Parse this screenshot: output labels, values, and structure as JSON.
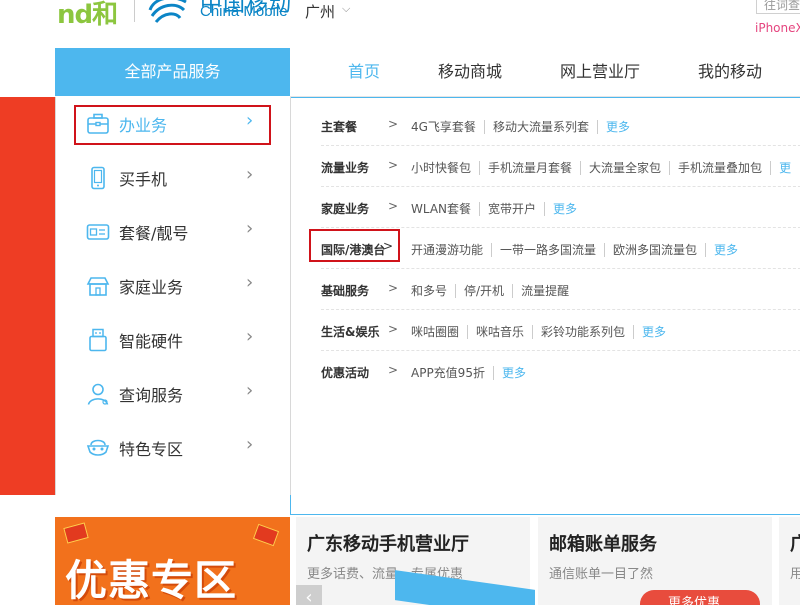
{
  "header": {
    "logo_he": "和",
    "brand_cn": "中国移动",
    "brand_en": "China Mobile",
    "city": "广州",
    "search_placeholder": "往词查",
    "hot_word": "iPhoneX"
  },
  "nav": {
    "all_services": "全部产品服务",
    "tabs": [
      {
        "label": "首页",
        "active": true
      },
      {
        "label": "移动商城",
        "active": false
      },
      {
        "label": "网上营业厅",
        "active": false
      },
      {
        "label": "我的移动",
        "active": false
      }
    ]
  },
  "menu": {
    "items": [
      {
        "label": "办业务",
        "icon": "briefcase-icon",
        "active": true
      },
      {
        "label": "买手机",
        "icon": "phone-icon",
        "active": false
      },
      {
        "label": "套餐/靓号",
        "icon": "sim-card-icon",
        "active": false
      },
      {
        "label": "家庭业务",
        "icon": "home-icon",
        "active": false
      },
      {
        "label": "智能硬件",
        "icon": "usb-device-icon",
        "active": false
      },
      {
        "label": "查询服务",
        "icon": "user-icon",
        "active": false
      },
      {
        "label": "特色专区",
        "icon": "mask-icon",
        "active": false
      }
    ],
    "arrow": "›"
  },
  "services": {
    "gt": ">",
    "more": "更多",
    "rows": [
      {
        "category": "主套餐",
        "links": [
          "4G飞享套餐",
          "移动大流量系列套"
        ],
        "more": true
      },
      {
        "category": "流量业务",
        "links": [
          "小时快餐包",
          "手机流量月套餐",
          "大流量全家包",
          "手机流量叠加包",
          "更"
        ],
        "more": false
      },
      {
        "category": "家庭业务",
        "links": [
          "WLAN套餐",
          "宽带开户"
        ],
        "more": true
      },
      {
        "category": "国际/港澳台",
        "links": [
          "开通漫游功能",
          "一带一路多国流量",
          "欧洲多国流量包"
        ],
        "more": true
      },
      {
        "category": "基础服务",
        "links": [
          "和多号",
          "停/开机",
          "流量提醒"
        ],
        "more": false
      },
      {
        "category": "生活&娱乐",
        "links": [
          "咪咕圈圈",
          "咪咕音乐",
          "彩铃功能系列包"
        ],
        "more": true
      },
      {
        "category": "优惠活动",
        "links": [
          "APP充值95折"
        ],
        "more": true
      }
    ]
  },
  "cards": {
    "promo_title": "优惠专区",
    "items": [
      {
        "title": "广东移动手机营业厅",
        "sub": "更多话费、流量、专属优惠"
      },
      {
        "title": "邮箱账单服务",
        "sub": "通信账单一目了然"
      },
      {
        "title": "广",
        "sub": "用"
      }
    ],
    "prev": "‹",
    "badge": "更多优惠"
  },
  "colors": {
    "accent": "#4db7ee",
    "banner_red": "#ee3d24",
    "highlight": "#d0131a",
    "logo_green": "#8cc63f",
    "brand_blue": "#0b85c6"
  }
}
